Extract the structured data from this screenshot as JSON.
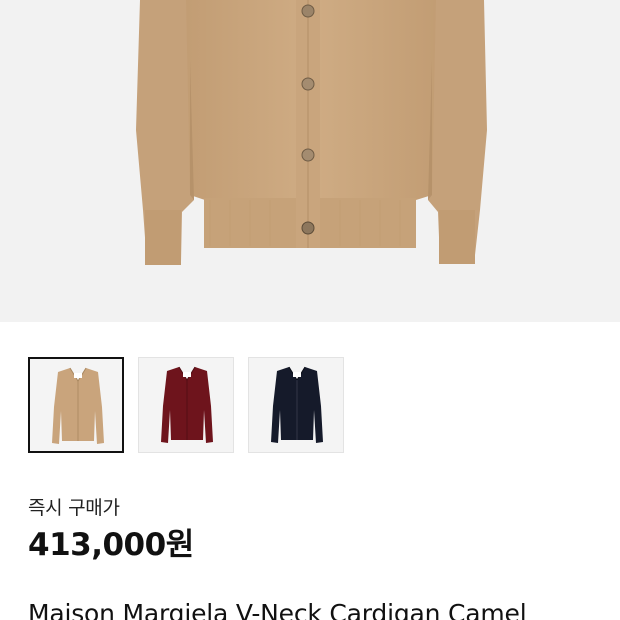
{
  "gallery": {
    "main_image": "camel-cardigan-photo",
    "thumbnails": [
      {
        "color_name": "Camel",
        "color": "#c9a47c",
        "selected": true
      },
      {
        "color_name": "Burgundy",
        "color": "#6e141c",
        "selected": false
      },
      {
        "color_name": "Navy",
        "color": "#151a2a",
        "selected": false
      }
    ]
  },
  "pricing": {
    "label": "즉시 구매가",
    "price": "413,000원"
  },
  "product": {
    "name": "Maison Margiela V-Neck Cardigan Camel"
  }
}
